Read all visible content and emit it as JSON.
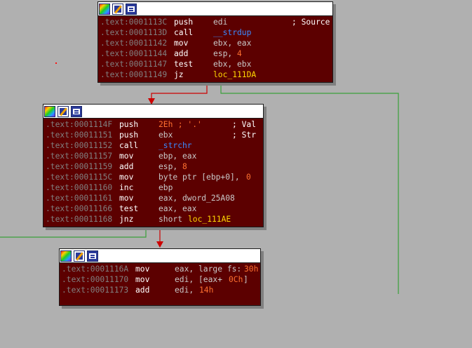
{
  "colors": {
    "background": "#b0b0b0",
    "node_fill": "#5c0000",
    "edge_false": "#cc0000",
    "edge_true": "#3aa03a"
  },
  "nodes": [
    {
      "toolbar_icons": [
        "graph-overview-icon",
        "edit-node-icon",
        "xref-icon"
      ],
      "rows": [
        {
          "addr": ".text:0001113C",
          "mnem": "push",
          "op": "edi",
          "comment": "; Source"
        },
        {
          "addr": ".text:0001113D",
          "mnem": "call",
          "op_sym": "__strdup"
        },
        {
          "addr": ".text:00011142",
          "mnem": "mov",
          "op": "ebx, eax"
        },
        {
          "addr": ".text:00011144",
          "mnem": "add",
          "op": "esp, ",
          "op_num": "4"
        },
        {
          "addr": ".text:00011147",
          "mnem": "test",
          "op": "ebx, ebx"
        },
        {
          "addr": ".text:00011149",
          "mnem": "jz",
          "op_lbl": "loc_111DA"
        }
      ]
    },
    {
      "toolbar_icons": [
        "graph-overview-icon",
        "edit-node-icon",
        "xref-icon"
      ],
      "rows": [
        {
          "addr": ".text:0001114F",
          "mnem": "push",
          "op_num": "2Eh",
          "inline": " ; '.'",
          "comment": "; Val"
        },
        {
          "addr": ".text:00011151",
          "mnem": "push",
          "op": "ebx",
          "comment": "; Str"
        },
        {
          "addr": ".text:00011152",
          "mnem": "call",
          "op_sym": "_strchr"
        },
        {
          "addr": ".text:00011157",
          "mnem": "mov",
          "op": "ebp, eax"
        },
        {
          "addr": ".text:00011159",
          "mnem": "add",
          "op": "esp, ",
          "op_num": "8"
        },
        {
          "addr": ".text:0001115C",
          "mnem": "mov",
          "op": "byte ptr [ebp+0], ",
          "op_num": "0"
        },
        {
          "addr": ".text:00011160",
          "mnem": "inc",
          "op": "ebp"
        },
        {
          "addr": ".text:00011161",
          "mnem": "mov",
          "op": "eax, dword_25A08"
        },
        {
          "addr": ".text:00011166",
          "mnem": "test",
          "op": "eax, eax"
        },
        {
          "addr": ".text:00011168",
          "mnem": "jnz",
          "op": "short ",
          "op_lbl": "loc_111AE"
        }
      ]
    },
    {
      "toolbar_icons": [
        "graph-overview-icon",
        "edit-node-icon",
        "xref-icon"
      ],
      "rows": [
        {
          "addr": ".text:0001116A",
          "mnem": "mov",
          "op": "eax, large fs:",
          "op_num": "30h"
        },
        {
          "addr": ".text:00011170",
          "mnem": "mov",
          "op": "edi, [eax+",
          "op_num": "0Ch",
          "op_tail": "]"
        },
        {
          "addr": ".text:00011173",
          "mnem": "add",
          "op": "edi, ",
          "op_num": "14h"
        }
      ]
    }
  ]
}
